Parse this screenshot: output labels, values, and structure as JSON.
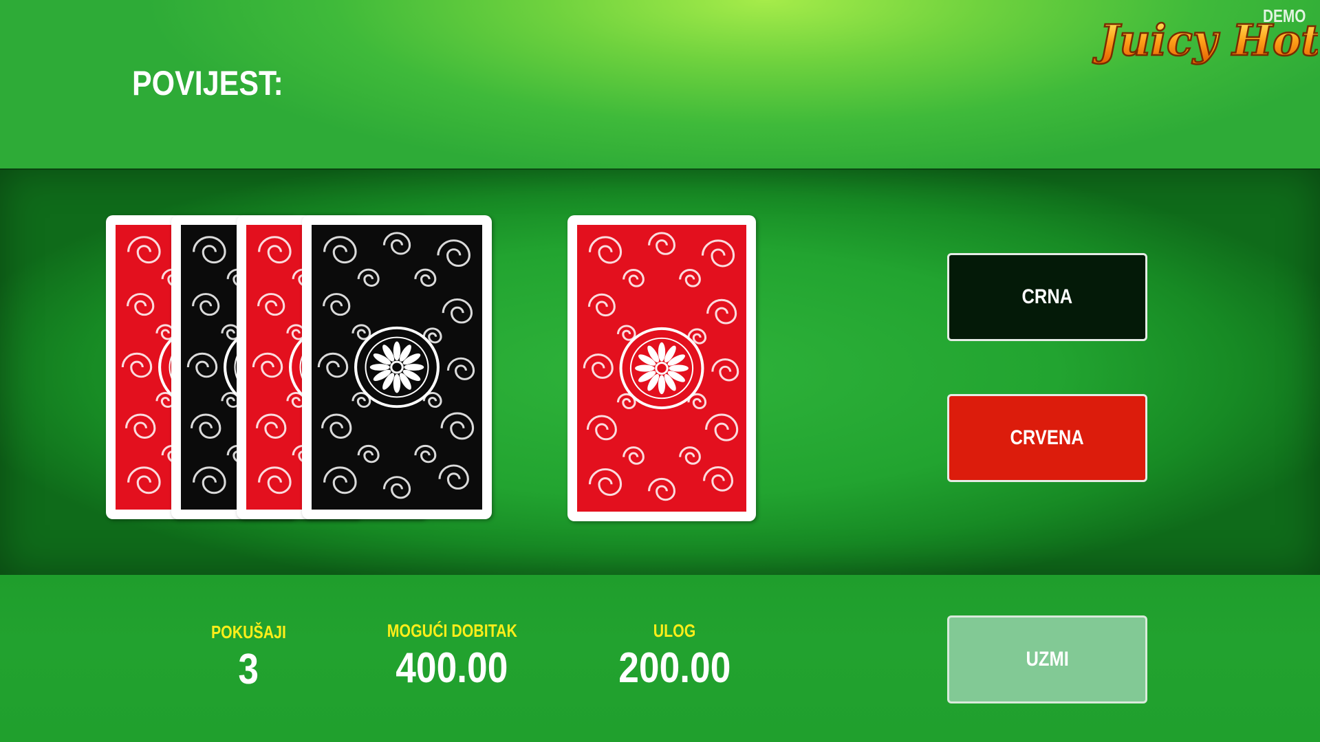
{
  "header": {
    "history_label": "POVIJEST:",
    "logo_text": "Juicy Hot",
    "demo_label": "DEMO"
  },
  "table": {
    "history_cards": [
      {
        "color": "red"
      },
      {
        "color": "black"
      },
      {
        "color": "red"
      },
      {
        "color": "black"
      }
    ],
    "current_card": {
      "color": "red",
      "face_down": true
    }
  },
  "buttons": {
    "black_label": "CRNA",
    "red_label": "CRVENA",
    "take_label": "UZMI"
  },
  "stats": {
    "attempts_label": "POKUŠAJI",
    "attempts_value": "3",
    "possible_win_label": "MOGUĆI DOBITAK",
    "possible_win_value": "400.00",
    "bet_label": "ULOG",
    "bet_value": "200.00"
  },
  "colors": {
    "card_red": "#e3101e",
    "card_black": "#0b0b0b",
    "label_yellow": "#ffee1a",
    "button_black": "#041a08",
    "button_red": "#dc1c0c",
    "button_take": "#82c995"
  }
}
